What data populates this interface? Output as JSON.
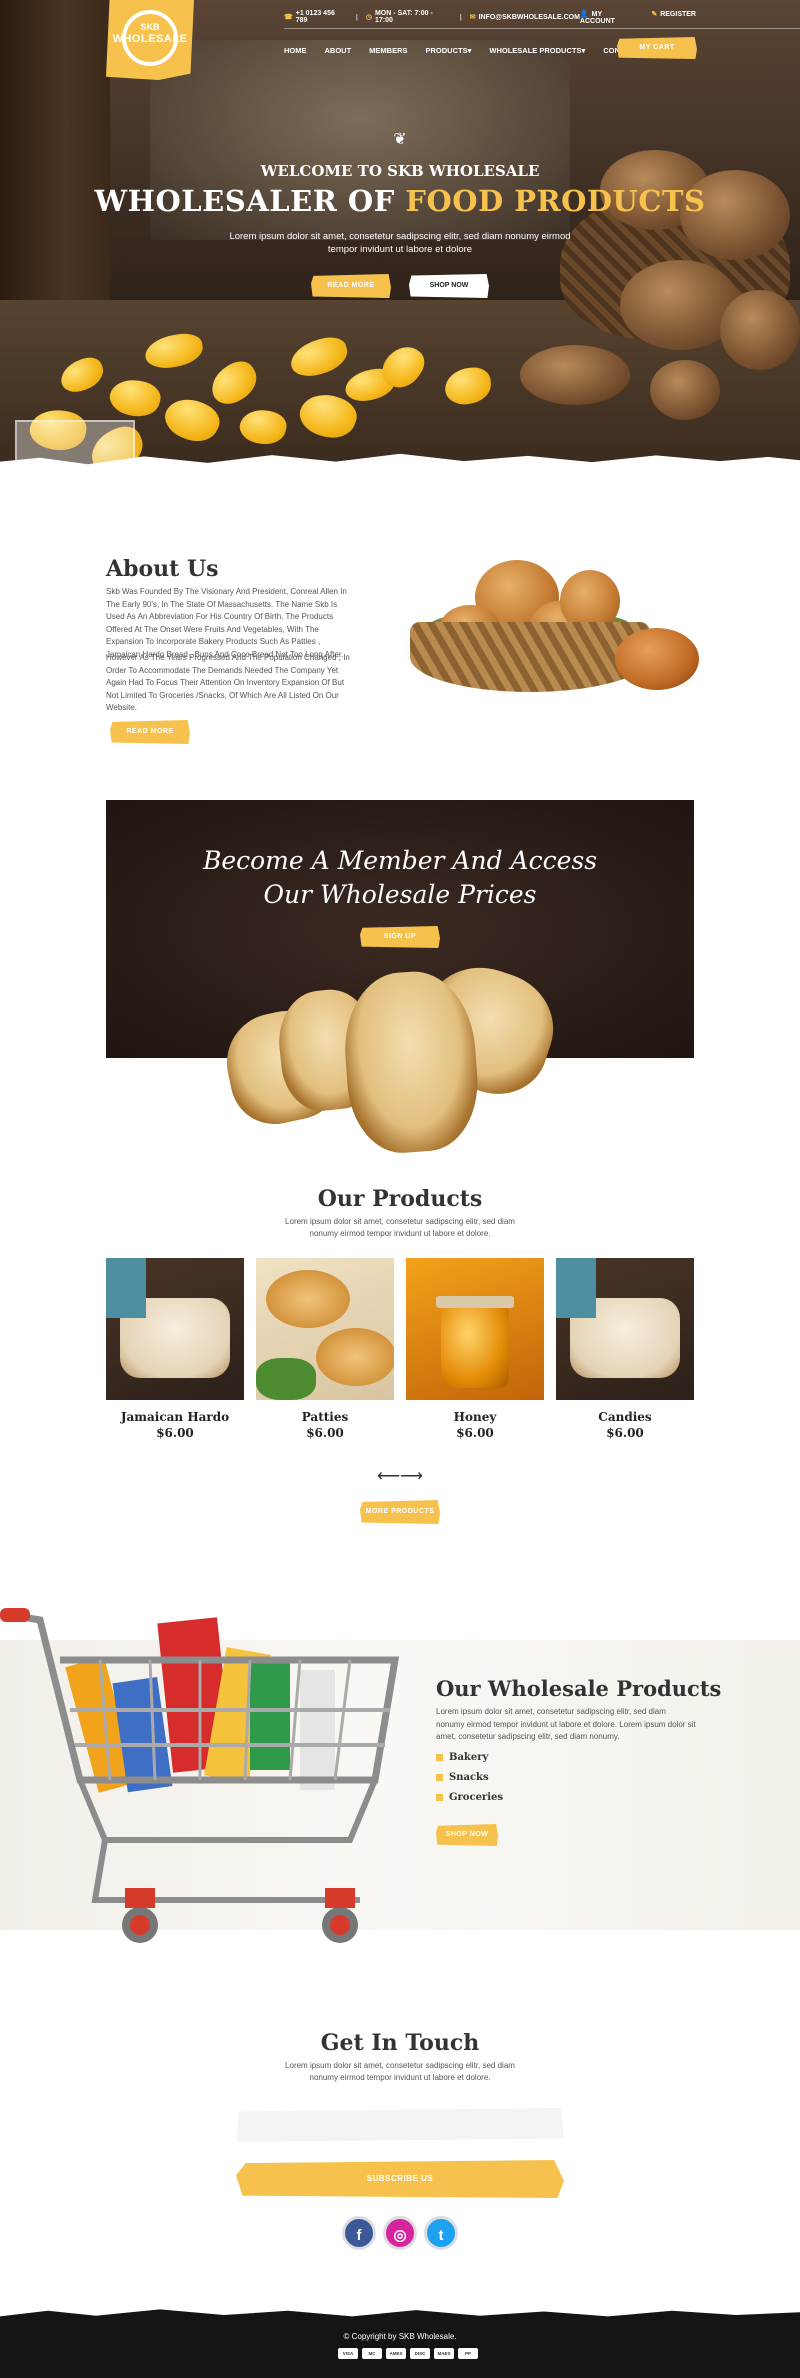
{
  "brand": {
    "logo_top": "SKB",
    "logo_bottom": "WHOLESALE"
  },
  "topbar": {
    "phone": "+1 0123 456 789",
    "hours": "MON - SAT: 7:00 - 17:00",
    "email": "INFO@SKBWHOLESALE.COM",
    "account": "MY ACCOUNT",
    "register": "REGISTER"
  },
  "nav": {
    "items": [
      "HOME",
      "ABOUT",
      "MEMBERS",
      "PRODUCTS",
      "WHOLESALE PRODUCTS",
      "CONTACT"
    ],
    "cart": "MY CART"
  },
  "hero": {
    "welcome": "WELCOME TO SKB WHOLESALE",
    "headline_a": "WHOLESALER OF ",
    "headline_b": "FOOD PRODUCTS",
    "sub": "Lorem ipsum dolor sit amet, consetetur sadipscing elitr, sed diam nonumy eirmod tempor invidunt ut labore et dolore",
    "read_more": "READ MORE",
    "shop_now": "SHOP NOW"
  },
  "about": {
    "title": "About Us",
    "p1": "Skb Was Founded By The Visionary And President, Conreal Allen In The Early 90's, In The State Of Massachusetts. The Name Skb Is Used As An Abbreviation For His Country Of Birth. The Products Offered At The Onset Were Fruits And Vegetables, With The Expansion To Incorporate Bakery Products Such As Patties , Jamaican Hardo Bread , Buns And Coco Bread Not Too Long After.",
    "p2": "However As The Years Progressed And The Population Changed , In Order To Accommodate The Demands Needed The Company Yet Again Had To Focus Their Attention On Inventory Expansion Of But Not Limited To Groceries /Snacks, Of Which Are All Listed On Our Website.",
    "button": "READ MORE"
  },
  "member": {
    "line1": "Become A Member And Access",
    "line2": "Our Wholesale Prices",
    "button": "SIGN UP"
  },
  "products": {
    "title": "Our Products",
    "sub": "Lorem ipsum dolor sit amet, consetetur sadipscing elitr, sed diam nonumy eirmod tempor invidunt ut labore et dolore.",
    "items": [
      {
        "name": "Jamaican Hardo",
        "price": "$6.00"
      },
      {
        "name": "Patties",
        "price": "$6.00"
      },
      {
        "name": "Honey",
        "price": "$6.00"
      },
      {
        "name": "Candies",
        "price": "$6.00"
      }
    ],
    "button": "MORE PRODUCTS"
  },
  "wholesale": {
    "title": "Our Wholesale Products",
    "text": "Lorem ipsum dolor sit amet, consetetur sadipscing elitr, sed diam nonumy eirmod tempor invidunt ut labore et dolore. Lorem ipsum dolor sit amet, consetetur sadipscing elitr, sed diam nonumy.",
    "list": [
      "Bakery",
      "Snacks",
      "Groceries"
    ],
    "button": "SHOP NOW"
  },
  "contact": {
    "title": "Get In Touch",
    "sub": "Lorem ipsum dolor sit amet, consetetur sadipscing elitr, sed diam nonumy eirmod tempor invidunt ut labore et dolore.",
    "email_placeholder": "",
    "button": "SUBSCRIBE US"
  },
  "social": [
    {
      "icon": "facebook-icon",
      "glyph": "f",
      "color": "#3b5998"
    },
    {
      "icon": "instagram-icon",
      "glyph": "◎",
      "color": "#d6249f"
    },
    {
      "icon": "twitter-icon",
      "glyph": "t",
      "color": "#1da1f2"
    }
  ],
  "footer": {
    "copyright": "© Copyright by SKB Wholesale.",
    "payments": [
      "VISA",
      "MC",
      "AMEX",
      "DISC",
      "MAES",
      "PP"
    ]
  },
  "colors": {
    "accent": "#f6c24d",
    "dark": "#141414"
  }
}
